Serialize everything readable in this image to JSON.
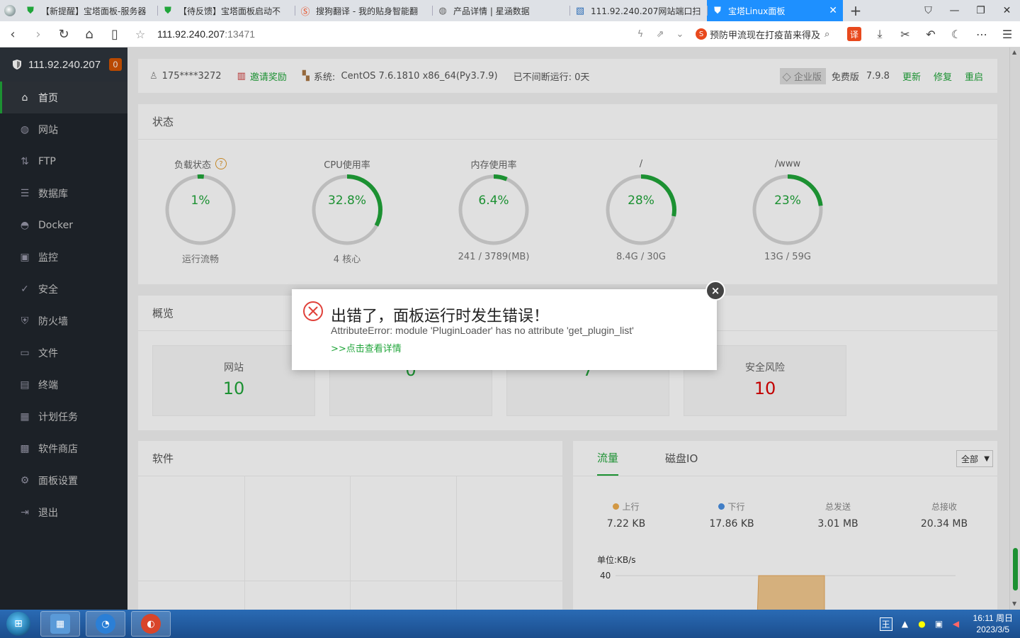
{
  "browser": {
    "tabs": [
      {
        "title": "【新提醒】宝塔面板-服务器",
        "favicon": "shield-icon",
        "color": "#20a53a"
      },
      {
        "title": "【待反馈】宝塔面板启动不",
        "favicon": "shield-icon",
        "color": "#20a53a"
      },
      {
        "title": "搜狗翻译 - 我的贴身智能翻",
        "favicon": "sogou-icon",
        "color": "#e8491d"
      },
      {
        "title": "产品详情 | 星涵数据",
        "favicon": "globe-icon",
        "color": "#666666"
      },
      {
        "title": "111.92.240.207网站端口扫",
        "favicon": "page-icon",
        "color": "#2a6bb5"
      },
      {
        "title": "宝塔Linux面板",
        "favicon": "shield-icon",
        "color": "#ffffff",
        "active": true
      }
    ],
    "url_host": "111.92.240.207",
    "url_port": ":13471",
    "search_text": "预防甲流现在打疫苗来得及",
    "translate_label": "译"
  },
  "sidebar": {
    "server_ip": "111.92.240.207",
    "badge": "0",
    "items": [
      {
        "label": "首页",
        "icon": "home-icon",
        "glyph": "⌂",
        "active": true
      },
      {
        "label": "网站",
        "icon": "globe-icon",
        "glyph": "◍"
      },
      {
        "label": "FTP",
        "icon": "ftp-icon",
        "glyph": "⇅"
      },
      {
        "label": "数据库",
        "icon": "database-icon",
        "glyph": "☰"
      },
      {
        "label": "Docker",
        "icon": "docker-icon",
        "glyph": "◓"
      },
      {
        "label": "监控",
        "icon": "monitor-icon",
        "glyph": "▣"
      },
      {
        "label": "安全",
        "icon": "shield-icon",
        "glyph": "✓"
      },
      {
        "label": "防火墙",
        "icon": "firewall-icon",
        "glyph": "⛨"
      },
      {
        "label": "文件",
        "icon": "folder-icon",
        "glyph": "▭"
      },
      {
        "label": "终端",
        "icon": "terminal-icon",
        "glyph": "▤"
      },
      {
        "label": "计划任务",
        "icon": "calendar-icon",
        "glyph": "▦"
      },
      {
        "label": "软件商店",
        "icon": "grid-icon",
        "glyph": "▩"
      },
      {
        "label": "面板设置",
        "icon": "gear-icon",
        "glyph": "⚙"
      },
      {
        "label": "退出",
        "icon": "logout-icon",
        "glyph": "⇥"
      }
    ]
  },
  "infobar": {
    "user": "175****3272",
    "invite": "邀请奖励",
    "system_label": "系统:",
    "system_value": "CentOS 7.6.1810 x86_64(Py3.7.9)",
    "uptime": "已不间断运行: 0天",
    "edition": "企业版",
    "free_label": "免费版",
    "version": "7.9.8",
    "update": "更新",
    "repair": "修复",
    "restart": "重启"
  },
  "status": {
    "title": "状态",
    "gauges": [
      {
        "label": "负载状态",
        "value": "1%",
        "percent": 1,
        "sub": "运行流畅",
        "help": "?"
      },
      {
        "label": "CPU使用率",
        "value": "32.8%",
        "percent": 32.8,
        "sub": "4 核心"
      },
      {
        "label": "内存使用率",
        "value": "6.4%",
        "percent": 6.4,
        "sub": "241 / 3789(MB)"
      },
      {
        "label": "/",
        "value": "28%",
        "percent": 28,
        "sub": "8.4G / 30G"
      },
      {
        "label": "/www",
        "value": "23%",
        "percent": 23,
        "sub": "13G / 59G"
      }
    ]
  },
  "overview": {
    "title": "概览",
    "boxes": [
      {
        "label": "网站",
        "value": "10"
      },
      {
        "label": "",
        "value": "0"
      },
      {
        "label": "",
        "value": "7"
      },
      {
        "label": "安全风险",
        "value": "10",
        "danger": true
      }
    ]
  },
  "software": {
    "title": "软件"
  },
  "traffic": {
    "tabs": [
      "流量",
      "磁盘IO"
    ],
    "select": "全部",
    "stats": [
      {
        "label": "上行",
        "value": "7.22 KB",
        "dot": "#f0ad4e"
      },
      {
        "label": "下行",
        "value": "17.86 KB",
        "dot": "#4a90e2"
      },
      {
        "label": "总发送",
        "value": "3.01 MB"
      },
      {
        "label": "总接收",
        "value": "20.34 MB"
      }
    ],
    "unit": "单位:KB/s",
    "y_tick": "40"
  },
  "dialog": {
    "title": "出错了，面板运行时发生错误！",
    "message": "AttributeError: module 'PluginLoader' has no attribute 'get_plugin_list'",
    "link": ">>点击查看详情",
    "close": "×"
  },
  "taskbar": {
    "clock_time": "16:11 周日",
    "clock_date": "2023/3/5",
    "ime": "王"
  }
}
